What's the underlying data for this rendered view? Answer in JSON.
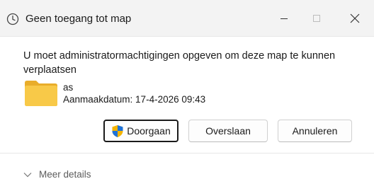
{
  "window": {
    "title": "Geen toegang tot map",
    "title_icon": "clock-icon",
    "controls": {
      "minimize_icon": "minimize-icon",
      "maximize_icon": "maximize-icon",
      "close_icon": "close-icon"
    }
  },
  "dialog": {
    "message": "U moet administratormachtigingen opgeven om deze map te kunnen verplaatsen",
    "item": {
      "icon": "folder-icon",
      "name": "as",
      "date": "Aanmaakdatum: 17-4-2026 09:43"
    },
    "buttons": {
      "continue_label": "Doorgaan",
      "continue_icon": "uac-shield-icon",
      "skip_label": "Overslaan",
      "cancel_label": "Annuleren"
    },
    "details_label": "Meer details",
    "details_icon": "chevron-down-icon"
  },
  "colors": {
    "titlebar_bg": "#f3f3f3",
    "folder_yellow": "#f6c543",
    "shield_blue": "#1e72d8",
    "shield_yellow": "#f4b400"
  }
}
